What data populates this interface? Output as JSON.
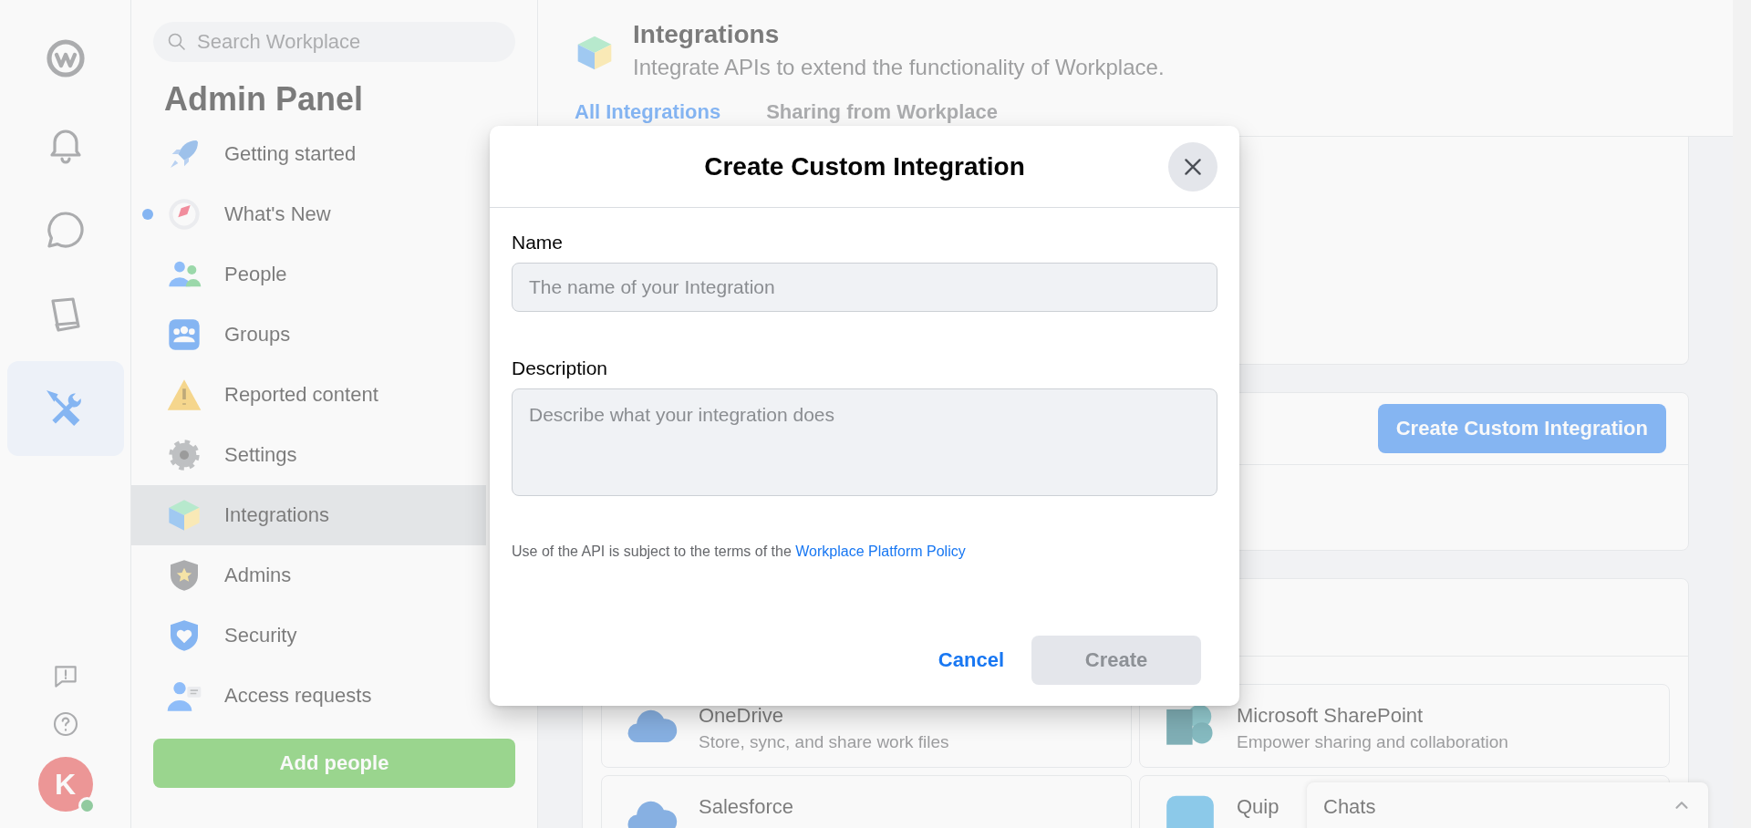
{
  "rail": {
    "items": [
      {
        "kind": "logo",
        "selected": false
      },
      {
        "kind": "bell",
        "selected": false
      },
      {
        "kind": "chat",
        "selected": false
      },
      {
        "kind": "book",
        "selected": false
      },
      {
        "kind": "tools",
        "selected": true
      }
    ],
    "bottom": [
      {
        "kind": "feedback"
      },
      {
        "kind": "help"
      }
    ],
    "avatar": {
      "initial": "K",
      "online": true
    }
  },
  "sidebar": {
    "search": {
      "placeholder": "Search Workplace"
    },
    "title": "Admin Panel",
    "items": [
      {
        "label": "Getting started",
        "kind": "rocket",
        "selected": false,
        "unread": false
      },
      {
        "label": "What's New",
        "kind": "compass",
        "selected": false,
        "unread": true
      },
      {
        "label": "People",
        "kind": "people",
        "selected": false,
        "unread": false
      },
      {
        "label": "Groups",
        "kind": "groups",
        "selected": false,
        "unread": false
      },
      {
        "label": "Reported content",
        "kind": "warning",
        "selected": false,
        "unread": false
      },
      {
        "label": "Settings",
        "kind": "gear",
        "selected": false,
        "unread": false
      },
      {
        "label": "Integrations",
        "kind": "cube",
        "selected": true,
        "unread": false
      },
      {
        "label": "Admins",
        "kind": "shield-star",
        "selected": false,
        "unread": false
      },
      {
        "label": "Security",
        "kind": "shield-heart",
        "selected": false,
        "unread": false
      },
      {
        "label": "Access requests",
        "kind": "request",
        "selected": false,
        "unread": false
      }
    ],
    "button": "Add people"
  },
  "main": {
    "title": "Integrations",
    "subtitle": "Integrate APIs to extend the functionality of Workplace.",
    "tabs": [
      {
        "label": "All Integrations",
        "selected": true
      },
      {
        "label": "Sharing from Workplace",
        "selected": false
      }
    ],
    "custom_button": "Create Custom Integration",
    "tiles": [
      {
        "kind": "cloud",
        "name": "OneDrive",
        "description": "Store, sync, and share work files"
      },
      {
        "kind": "sharepoint",
        "name": "Microsoft SharePoint",
        "description": "Empower sharing and collaboration"
      },
      {
        "kind": "cloud",
        "name": "Salesforce"
      },
      {
        "kind": "quip",
        "name": "Quip"
      }
    ]
  },
  "chats": {
    "label": "Chats"
  },
  "dialog": {
    "title": "Create Custom Integration",
    "fields": [
      {
        "kind": "input",
        "label": "Name",
        "placeholder": "The name of your Integration"
      },
      {
        "kind": "textarea",
        "label": "Description",
        "placeholder": "Describe what your integration does"
      }
    ],
    "policy": {
      "text": "Use of the API is subject to the terms of the",
      "link": "Workplace Platform Policy"
    },
    "cancel": "Cancel",
    "create": {
      "label": "Create",
      "disabled": true
    }
  }
}
